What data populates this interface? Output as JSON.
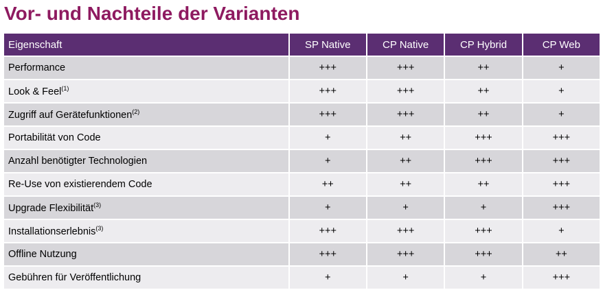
{
  "title": "Vor- und Nachteile der Varianten",
  "header": {
    "property": "Eigenschaft",
    "columns": [
      "SP Native",
      "CP Native",
      "CP Hybrid",
      "CP Web"
    ]
  },
  "rows": [
    {
      "label": "Performance",
      "note": "",
      "values": [
        "+++",
        "+++",
        "++",
        "+"
      ]
    },
    {
      "label": "Look & Feel",
      "note": "(1)",
      "values": [
        "+++",
        "+++",
        "++",
        "+"
      ]
    },
    {
      "label": "Zugriff auf Gerätefunktionen",
      "note": "(2)",
      "values": [
        "+++",
        "+++",
        "++",
        "+"
      ]
    },
    {
      "label": "Portabilität von Code",
      "note": "",
      "values": [
        "+",
        "++",
        "+++",
        "+++"
      ]
    },
    {
      "label": "Anzahl benötigter Technologien",
      "note": "",
      "values": [
        "+",
        "++",
        "+++",
        "+++"
      ]
    },
    {
      "label": "Re-Use von existierendem Code",
      "note": "",
      "values": [
        "++",
        "++",
        "++",
        "+++"
      ]
    },
    {
      "label": "Upgrade Flexibilität",
      "note": "(3)",
      "values": [
        "+",
        "+",
        "+",
        "+++"
      ]
    },
    {
      "label": "Installationserlebnis",
      "note": "(3)",
      "values": [
        "+++",
        "+++",
        "+++",
        "+"
      ]
    },
    {
      "label": "Offline Nutzung",
      "note": "",
      "values": [
        "+++",
        "+++",
        "+++",
        "++"
      ]
    },
    {
      "label": "Gebühren für Veröffentlichung",
      "note": "",
      "values": [
        "+",
        "+",
        "+",
        "+++"
      ]
    }
  ],
  "colors": {
    "title": "#8e1a60",
    "header_bg": "#5b2e72",
    "row_dark": "#d7d6da",
    "row_light": "#edecef"
  }
}
